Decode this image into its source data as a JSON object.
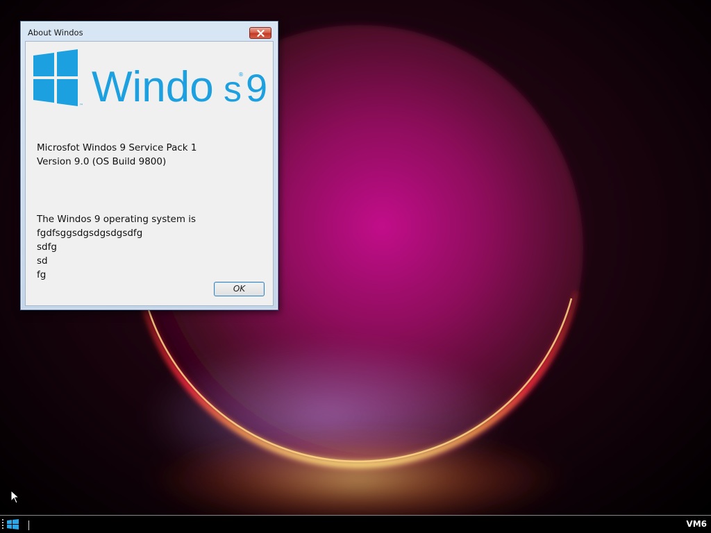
{
  "dialog": {
    "title": "About Windos",
    "logo_text_left": "Windo",
    "logo_text_right": "s",
    "logo_version": "9",
    "product_line": "Microsfot Windos 9 Service Pack 1",
    "version_line": "Version 9.0 (OS Build 9800)",
    "description_lines": [
      "The Windos 9 operating system is",
      "fgdfsggsdgsdgsdgsdfg",
      "sdfg",
      "sd",
      "fg"
    ],
    "ok_label": "OK",
    "close_icon": "close-icon"
  },
  "taskbar": {
    "start_icon": "windows-logo-icon",
    "tray_label": "VM6"
  },
  "colors": {
    "logo_blue": "#1ca0e0",
    "close_red": "#c23a22",
    "ok_border": "#3c7fb1"
  }
}
